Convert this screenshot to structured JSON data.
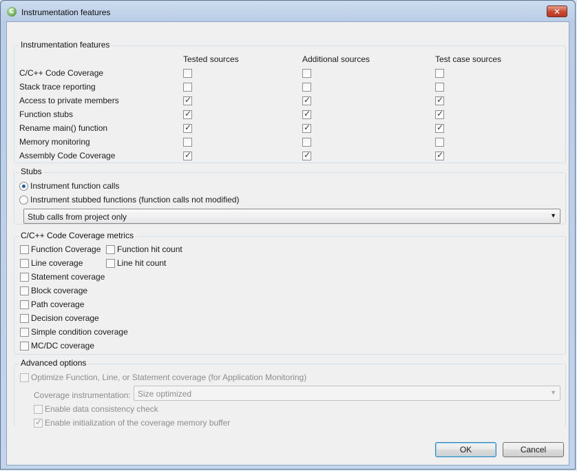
{
  "window": {
    "title": "Instrumentation features",
    "close_label": "✕"
  },
  "features": {
    "legend": "Instrumentation features",
    "columns": [
      "Tested sources",
      "Additional sources",
      "Test case sources"
    ],
    "rows": [
      {
        "label": "C/C++ Code Coverage",
        "checked": [
          false,
          false,
          false
        ]
      },
      {
        "label": "Stack trace reporting",
        "checked": [
          false,
          false,
          false
        ]
      },
      {
        "label": "Access to private members",
        "checked": [
          true,
          true,
          true
        ]
      },
      {
        "label": "Function stubs",
        "checked": [
          true,
          true,
          true
        ]
      },
      {
        "label": "Rename main() function",
        "checked": [
          true,
          true,
          true
        ]
      },
      {
        "label": "Memory monitoring",
        "checked": [
          false,
          false,
          false
        ]
      },
      {
        "label": "Assembly Code Coverage",
        "checked": [
          true,
          true,
          true
        ]
      }
    ]
  },
  "stubs": {
    "legend": "Stubs",
    "radio_instrument_calls": "Instrument function calls",
    "radio_instrument_stubbed": "Instrument stubbed functions (function calls not modified)",
    "selected_radio": "instrument_calls",
    "combo_value": "Stub calls from project only"
  },
  "metrics": {
    "legend": "C/C++ Code Coverage metrics",
    "items": {
      "function_coverage": "Function Coverage",
      "function_hit_count": "Function hit count",
      "line_coverage": "Line coverage",
      "line_hit_count": "Line hit count",
      "statement_coverage": "Statement coverage",
      "block_coverage": "Block coverage",
      "path_coverage": "Path coverage",
      "decision_coverage": "Decision coverage",
      "simple_condition_coverage": "Simple condition coverage",
      "mcdc_coverage": "MC/DC coverage"
    }
  },
  "advanced": {
    "legend": "Advanced options",
    "optimize_label": "Optimize Function, Line, or Statement coverage (for Application Monitoring)",
    "coverage_instr_label": "Coverage instrumentation:",
    "coverage_instr_value": "Size optimized",
    "data_consistency_label": "Enable data consistency check",
    "enable_init_label": "Enable initialization of the coverage memory buffer",
    "enable_init_checked": true
  },
  "buttons": {
    "ok": "OK",
    "cancel": "Cancel"
  },
  "icons": {
    "app": "testrt-app-icon",
    "close": "close-icon",
    "dropdown": "chevron-down-icon"
  }
}
